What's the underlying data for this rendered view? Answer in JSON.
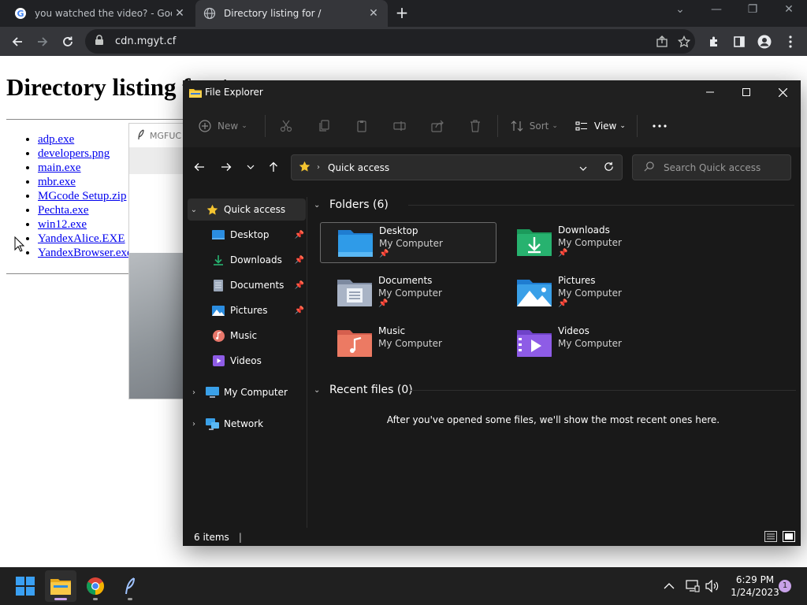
{
  "browser": {
    "tabs": [
      {
        "title": "you watched the video? - Google",
        "active": false
      },
      {
        "title": "Directory listing for /",
        "active": true
      }
    ],
    "url": "cdn.mgyt.cf"
  },
  "webpage": {
    "heading": "Directory listing for /",
    "files": [
      "adp.exe",
      "developers.png",
      "main.exe",
      "mbr.exe",
      "MGcode Setup.zip",
      "Pechta.exe",
      "win12.exe",
      "YandexAlice.EXE",
      "YandexBrowser.exe"
    ]
  },
  "background_window": {
    "title": "MGFUC"
  },
  "explorer": {
    "title": "File Explorer",
    "toolbar": {
      "new_label": "New",
      "sort_label": "Sort",
      "view_label": "View"
    },
    "address": {
      "location": "Quick access",
      "search_placeholder": "Search Quick access"
    },
    "nav": {
      "quick_access": "Quick access",
      "items": [
        {
          "label": "Desktop",
          "pinned": true,
          "icon": "desktop-icon"
        },
        {
          "label": "Downloads",
          "pinned": true,
          "icon": "downloads-icon"
        },
        {
          "label": "Documents",
          "pinned": true,
          "icon": "documents-icon"
        },
        {
          "label": "Pictures",
          "pinned": true,
          "icon": "pictures-icon"
        },
        {
          "label": "Music",
          "pinned": false,
          "icon": "music-icon"
        },
        {
          "label": "Videos",
          "pinned": false,
          "icon": "videos-icon"
        }
      ],
      "my_computer": "My Computer",
      "network": "Network"
    },
    "folders_header": "Folders (6)",
    "folders": [
      {
        "name": "Desktop",
        "location": "My Computer",
        "pinned": true
      },
      {
        "name": "Downloads",
        "location": "My Computer",
        "pinned": true
      },
      {
        "name": "Documents",
        "location": "My Computer",
        "pinned": true
      },
      {
        "name": "Pictures",
        "location": "My Computer",
        "pinned": true
      },
      {
        "name": "Music",
        "location": "My Computer",
        "pinned": false
      },
      {
        "name": "Videos",
        "location": "My Computer",
        "pinned": false
      }
    ],
    "recent_header": "Recent files (0)",
    "recent_empty_message": "After you've opened some files, we'll show the most recent ones here.",
    "status": "6 items"
  },
  "taskbar": {
    "time": "6:29 PM",
    "date": "1/24/2023",
    "notifications": "1"
  },
  "colors": {
    "explorer_bg": "#191919",
    "taskbar_bg": "#202020",
    "link": "#0000ee",
    "accent_yellow": "#f4c430"
  }
}
